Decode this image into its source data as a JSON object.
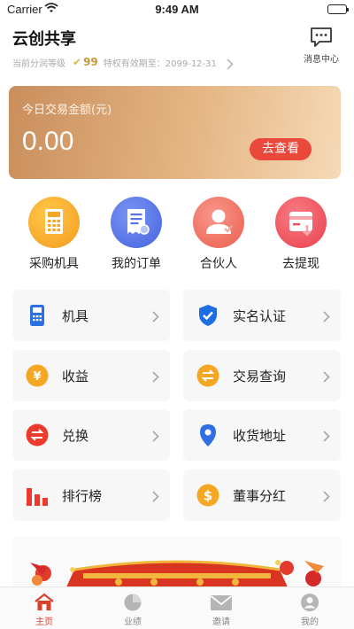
{
  "status_bar": {
    "carrier": "Carrier",
    "time": "9:49 AM"
  },
  "header": {
    "title": "云创共享",
    "tier_label": "当前分润等级",
    "tier_level": "99",
    "privilege_expiry": "特权有效期至：2099-12-31",
    "message_center": "消息中心"
  },
  "amount_card": {
    "label": "今日交易金额(元)",
    "value": "0.00",
    "button": "去查看"
  },
  "quick_actions": [
    {
      "label": "采购机具",
      "icon": "calculator-icon",
      "color": "#f6a623"
    },
    {
      "label": "我的订单",
      "icon": "receipt-icon",
      "color": "#5474e8"
    },
    {
      "label": "合伙人",
      "icon": "partner-icon",
      "color": "#ef6b5a"
    },
    {
      "label": "去提现",
      "icon": "withdraw-icon",
      "color": "#ef4d59"
    }
  ],
  "grid_menu": [
    {
      "label": "机具",
      "icon": "pos-terminal-icon",
      "color": "#2b6fe0"
    },
    {
      "label": "实名认证",
      "icon": "shield-check-icon",
      "color": "#1c6fe3"
    },
    {
      "label": "收益",
      "icon": "yen-coin-icon",
      "color": "#f5a623"
    },
    {
      "label": "交易查询",
      "icon": "exchange-coin-icon",
      "color": "#f5a623"
    },
    {
      "label": "兑换",
      "icon": "swap-icon",
      "color": "#ec3b2c"
    },
    {
      "label": "收货地址",
      "icon": "location-pin-icon",
      "color": "#2f6fe3"
    },
    {
      "label": "排行榜",
      "icon": "bar-chart-icon",
      "color": "#ec3b2c"
    },
    {
      "label": "董事分红",
      "icon": "dollar-coin-icon",
      "color": "#f5a623"
    }
  ],
  "tab_bar": [
    {
      "label": "主页",
      "icon": "home-icon",
      "active": true
    },
    {
      "label": "业绩",
      "icon": "pie-chart-icon",
      "active": false
    },
    {
      "label": "邀请",
      "icon": "mail-icon",
      "active": false
    },
    {
      "label": "我的",
      "icon": "user-icon",
      "active": false
    }
  ],
  "colors": {
    "accent_red": "#e9483b",
    "tab_active": "#d9412c",
    "card_gradient_start": "#c98e5c",
    "card_gradient_end": "#f5dab6"
  }
}
